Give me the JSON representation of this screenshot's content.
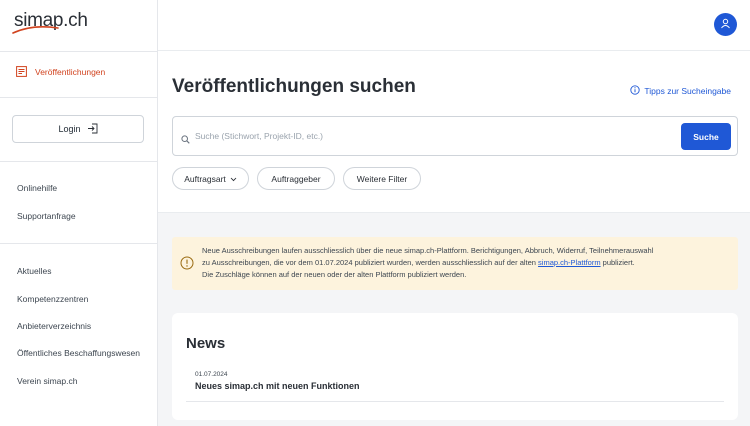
{
  "brand": {
    "name": "simap.ch",
    "accent": "#d1431f",
    "primary": "#1f58d6"
  },
  "sidebar": {
    "active_item": {
      "label": "Veröffentlichungen",
      "icon": "document-list-icon"
    },
    "login": {
      "label": "Login",
      "icon": "login-icon"
    },
    "help_links": [
      "Onlinehilfe",
      "Supportanfrage"
    ],
    "info_links": [
      "Aktuelles",
      "Kompetenzzentren",
      "Anbieterverzeichnis",
      "Öffentliches Beschaffungswesen",
      "Verein simap.ch"
    ]
  },
  "header": {
    "avatar_icon": "user-icon"
  },
  "search": {
    "title": "Veröffentlichungen suchen",
    "tips_label": "Tipps zur Sucheingabe",
    "placeholder": "Suche (Stichwort, Projekt-ID, etc.)",
    "value": "",
    "button_label": "Suche",
    "filters": [
      "Auftragsart",
      "Auftraggeber",
      "Weitere Filter"
    ]
  },
  "notice": {
    "line1": "Neue Ausschreibungen laufen ausschliesslich über die neue simap.ch-Plattform. Berichtigungen, Abbruch, Widerruf, Teilnehmerauswahl",
    "line2_before": "zu Ausschreibungen, die vor dem 01.07.2024 publiziert wurden, werden ausschliesslich auf der alten ",
    "line2_link": "simap.ch-Plattform",
    "line2_after": " publiziert.",
    "line3": "Die Zuschläge können auf der neuen oder der alten Plattform publiziert werden."
  },
  "news": {
    "title": "News",
    "items": [
      {
        "date": "01.07.2024",
        "title": "Neues simap.ch mit neuen Funktionen"
      }
    ]
  }
}
